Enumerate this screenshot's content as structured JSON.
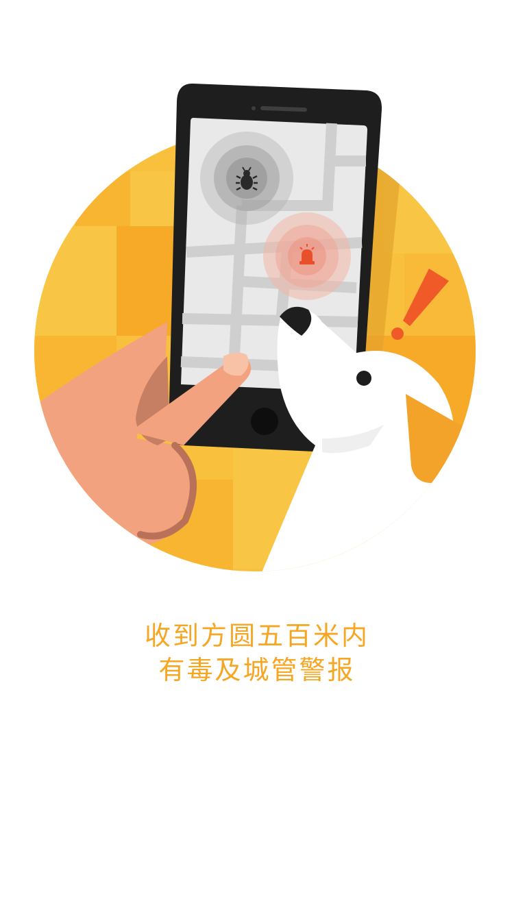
{
  "onboarding": {
    "caption_line_1": "收到方圆五百米内",
    "caption_line_2": "有毒及城管警报",
    "accent_color": "#F5A623"
  },
  "illustration": {
    "icons": [
      "bug-icon",
      "siren-icon",
      "exclamation-icon"
    ],
    "colors": {
      "circle_background": "#F8C03C",
      "phone_body": "#222222",
      "screen": "#E9E9E9",
      "hand": "#F2A27E",
      "alert": "#F05A28",
      "bird": "#FFFFFF"
    }
  }
}
